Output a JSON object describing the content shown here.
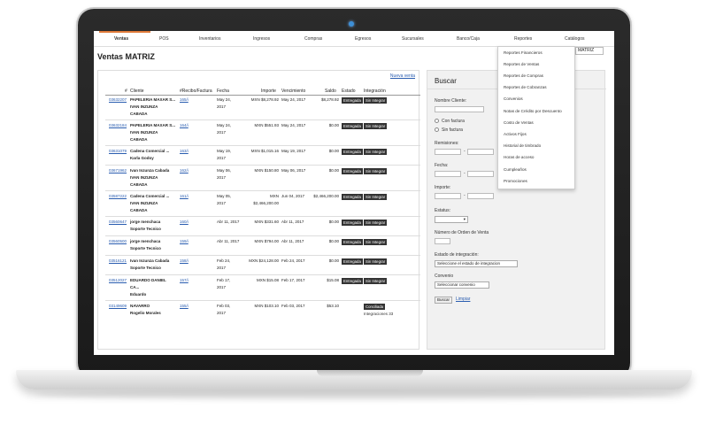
{
  "nav": {
    "items": [
      "Ventas",
      "POS",
      "Inventarios",
      "Ingresos",
      "Compras",
      "Egresos",
      "Sucursales",
      "Banco/Caja",
      "Reportes",
      "Catálogos"
    ]
  },
  "header": {
    "title": "Ventas MATRIZ",
    "branch_select": "MATRIZ"
  },
  "reports_menu": {
    "items": [
      "Reportes Financieros",
      "Reportes de Ventas",
      "Reportes de Compras",
      "Reportes de Cobranzas",
      "Convenios",
      "Notas de Crédito por Descuento",
      "Costo de Ventas",
      "Activos Fijos",
      "Historial de timbrado",
      "Horas de acceso",
      "Cumpleaños",
      "Promociones"
    ]
  },
  "table": {
    "new_sale_link": "Nueva venta",
    "columns": [
      "#",
      "Cliente",
      "#Recibo/Factura",
      "Fecha",
      "Importe",
      "Vencimiento",
      "Saldo",
      "Estado",
      "Integración"
    ],
    "rows": [
      {
        "id": "03632207",
        "cliente": [
          "PAPELERIA MAXAR S...",
          "IVAN INZUNZA",
          "CABADA"
        ],
        "recibo": "165/i",
        "fecha": [
          "May 24,",
          "2017"
        ],
        "importe": "MXN $8,278.92",
        "vencimiento": "May 24, 2017",
        "saldo": "$8,278.92",
        "estado": "Entregada",
        "integracion": "Sin Integrar"
      },
      {
        "id": "03632184",
        "cliente": [
          "PAPELERIA MAXAR S...",
          "IVAN INZUNZA",
          "CABADA"
        ],
        "recibo": "164/i",
        "fecha": [
          "May 24,",
          "2017"
        ],
        "importe": "MXN $551.93",
        "vencimiento": "May 24, 2017",
        "saldo": "$0.00",
        "estado": "Entregada",
        "integracion": "Sin Integrar"
      },
      {
        "id": "03631079",
        "cliente": [
          "Cadena Comercial ...",
          "Karla Godoy"
        ],
        "recibo": "163/i",
        "fecha": [
          "May 19,",
          "2017"
        ],
        "importe": "MXN $1,015.16",
        "vencimiento": "May 19, 2017",
        "saldo": "$0.00",
        "estado": "Entregada",
        "integracion": "Sin Integrar"
      },
      {
        "id": "03671962",
        "cliente": [
          "Ivan Inzunza Cabada",
          "IVAN INZUNZA",
          "CABADA"
        ],
        "recibo": "162/i",
        "fecha": [
          "May 06,",
          "2017"
        ],
        "importe": "MXN $150.80",
        "vencimiento": "May 06, 2017",
        "saldo": "$0.00",
        "estado": "Entregada",
        "integracion": "Sin Integrar"
      },
      {
        "id": "03587222",
        "cliente": [
          "Cadena Comercial ...",
          "IVAN INZUNZA",
          "CABADA"
        ],
        "recibo": "161/i",
        "fecha": [
          "May 05,",
          "2017"
        ],
        "importe": [
          "MXN",
          "$2,466,200.00"
        ],
        "vencimiento": "Jun 04, 2017",
        "saldo": "$2,466,200.00",
        "estado": "Entregada",
        "integracion": "Sin Integrar"
      },
      {
        "id": "03560647",
        "cliente": [
          "jorge menchaca",
          "Soporte Tecnico"
        ],
        "recibo": "160/i",
        "fecha": [
          "Abr 11, 2017"
        ],
        "importe": "MXN $331.60",
        "vencimiento": "Abr 11, 2017",
        "saldo": "$0.00",
        "estado": "Entregada",
        "integracion": "Sin Integrar"
      },
      {
        "id": "03560500",
        "cliente": [
          "jorge menchaca",
          "Soporte Tecnico"
        ],
        "recibo": "159/i",
        "fecha": [
          "Abr 11, 2017"
        ],
        "importe": "MXN $794.00",
        "vencimiento": "Abr 11, 2017",
        "saldo": "$0.00",
        "estado": "Entregada",
        "integracion": "Sin Integrar"
      },
      {
        "id": "03516121",
        "cliente": [
          "Ivan Inzunza Cabada",
          "Soporte Tecnico"
        ],
        "recibo": "158/i",
        "fecha": [
          "Feb 24,",
          "2017"
        ],
        "importe": "MXN $24,128.00",
        "vencimiento": "Feb 24, 2017",
        "saldo": "$0.00",
        "estado": "Entregada",
        "integracion": "Sin Integrar"
      },
      {
        "id": "03512027",
        "cliente": [
          "EDUARDO DANIEL",
          "CA...",
          "Eduardo"
        ],
        "recibo": "157/i",
        "fecha": [
          "Feb 17,",
          "2017"
        ],
        "importe": "MXN $15.08",
        "vencimiento": "Feb 17, 2017",
        "saldo": "$15.08",
        "estado": "Entregada",
        "integracion": "Sin Integrar"
      },
      {
        "id": "03149609",
        "cliente": [
          "NAVARRO",
          "Rogelio Morales"
        ],
        "recibo": "155/i",
        "fecha": [
          "Feb 03,",
          "2017"
        ],
        "importe": "MXN $103.10",
        "vencimiento": "Feb 03, 2017",
        "saldo": "$53.10",
        "estado": "Entregada",
        "integracion": "Conciliada"
      }
    ],
    "footer": "Integraciones 33"
  },
  "search": {
    "title": "Buscar",
    "cliente_label": "Nombre Cliente:",
    "con_factura": "Con factura",
    "sin_factura": "Sin factura",
    "remisiones_label": "Remisiones:",
    "fecha_label": "Fecha:",
    "importe_label": "Importe:",
    "estatus_label": "Estatus:",
    "orden_label": "Número de Orden de Venta",
    "integracion_label": "Estado de integración:",
    "integracion_select": "Seleccione el estado de integracion",
    "convenio_label": "Convenio",
    "convenio_select": "Seleccionar convenio",
    "buscar_button": "Buscar",
    "limpiar_link": "Limpiar"
  }
}
